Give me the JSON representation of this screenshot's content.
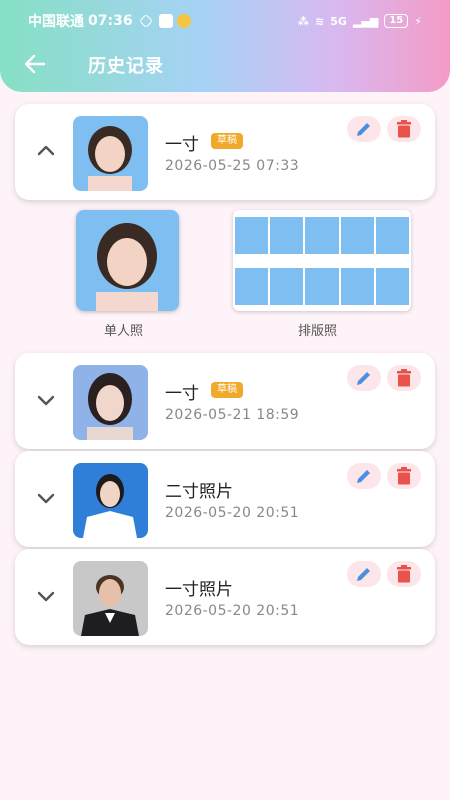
{
  "status": {
    "carrier": "中国联通",
    "time": "07:36",
    "network": "5G",
    "battery": "15"
  },
  "header": {
    "title": "历史记录"
  },
  "records": [
    {
      "name": "一寸",
      "badge": "草稿",
      "date": "2026-05-25 07:33",
      "expanded": true,
      "photo_bg": "#7fbef0"
    },
    {
      "name": "一寸",
      "badge": "草稿",
      "date": "2026-05-21 18:59",
      "expanded": false,
      "photo_bg": "#8fb2e8"
    },
    {
      "name": "二寸照片",
      "badge": "",
      "date": "2026-05-20 20:51",
      "expanded": false,
      "photo_bg": "#2f7fd8"
    },
    {
      "name": "一寸照片",
      "badge": "",
      "date": "2026-05-20 20:51",
      "expanded": false,
      "photo_bg": "#c8c8c8"
    }
  ],
  "expanded_panel": {
    "single_label": "单人照",
    "sheet_label": "排版照"
  },
  "colors": {
    "accent_red": "#e8524a",
    "edit_blue": "#4a8fe0",
    "badge": "#f0a92a"
  }
}
